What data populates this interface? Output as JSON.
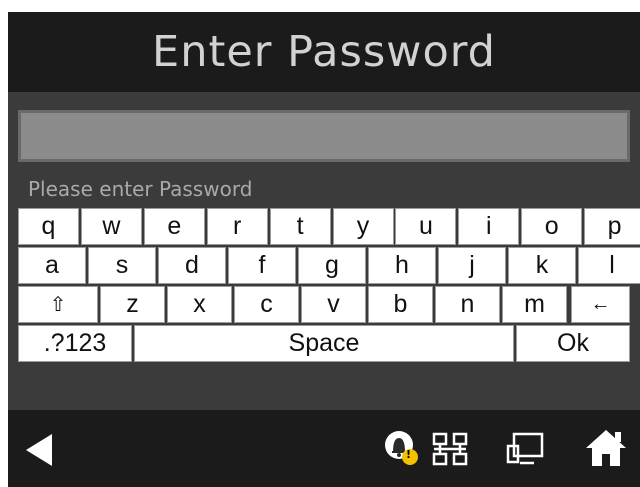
{
  "header": {
    "title": "Enter Password"
  },
  "password_field": {
    "value": ""
  },
  "hint": "Please enter Password",
  "keyboard": {
    "row1": [
      "q",
      "w",
      "e",
      "r",
      "t",
      "y",
      "u",
      "i",
      "o",
      "p"
    ],
    "row2": [
      "a",
      "s",
      "d",
      "f",
      "g",
      "h",
      "j",
      "k",
      "l"
    ],
    "row3": {
      "shift": "⇧",
      "letters": [
        "z",
        "x",
        "c",
        "v",
        "b",
        "n",
        "m"
      ],
      "backspace": "←"
    },
    "row4": {
      "mode": ".?123",
      "space": "Space",
      "ok": "Ok"
    }
  },
  "navbar": {
    "notification_badge": "!",
    "icons": [
      "back-icon",
      "notification-bell-icon",
      "network-icon",
      "display-icon",
      "home-icon"
    ]
  },
  "colors": {
    "titlebar": "#1b1b1b",
    "body": "#3b3b3b",
    "field": "#8a8b8a",
    "badge": "#f2c200"
  }
}
